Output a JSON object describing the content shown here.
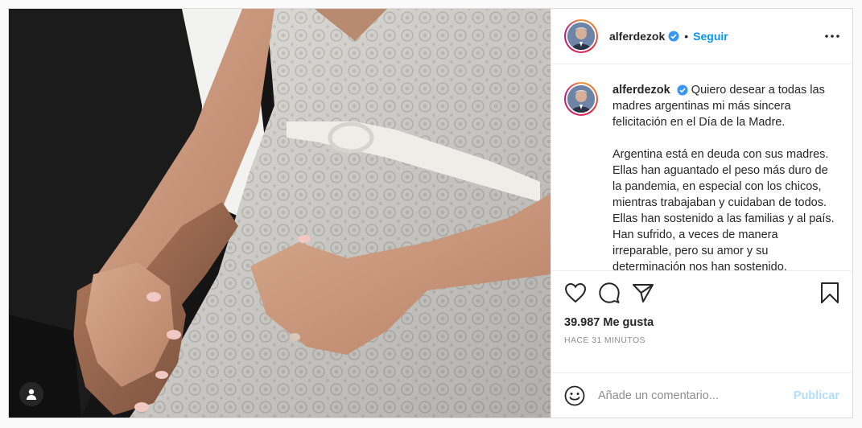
{
  "post": {
    "image_alt": "",
    "author": {
      "username": "alferdezok",
      "verified": true,
      "follow_label": "Seguir",
      "separator": "•"
    },
    "caption": {
      "username": "alferdezok",
      "paragraph_1": "Quiero desear a todas las madres argentinas mi más sincera felicitación en el Día de la Madre.",
      "paragraph_2": "Argentina está en deuda con sus madres. Ellas han aguantado el peso más duro de la pandemia, en especial con los chicos, mientras trabajaban y cuidaban de todos. Ellas han sostenido a las familias y al país. Han sufrido, a veces de manera irreparable, pero su amor y su determinación nos han sostenido. Sabemos..."
    },
    "likes_text": "39.987 Me gusta",
    "timestamp": "HACE 31 MINUTOS",
    "comment": {
      "placeholder": "Añade un comentario...",
      "value": "",
      "publish_label": "Publicar"
    },
    "icons": {
      "like": "heart-icon",
      "comment": "comment-icon",
      "share": "share-icon",
      "save": "bookmark-icon",
      "emoji": "emoji-icon",
      "options": "more-options-icon",
      "tag": "user-tag-icon"
    },
    "colors": {
      "link": "#0095f6",
      "publish_disabled": "#b2dffc",
      "verified": "#3897f0",
      "text": "#262626",
      "muted": "#8e8e8e"
    }
  }
}
